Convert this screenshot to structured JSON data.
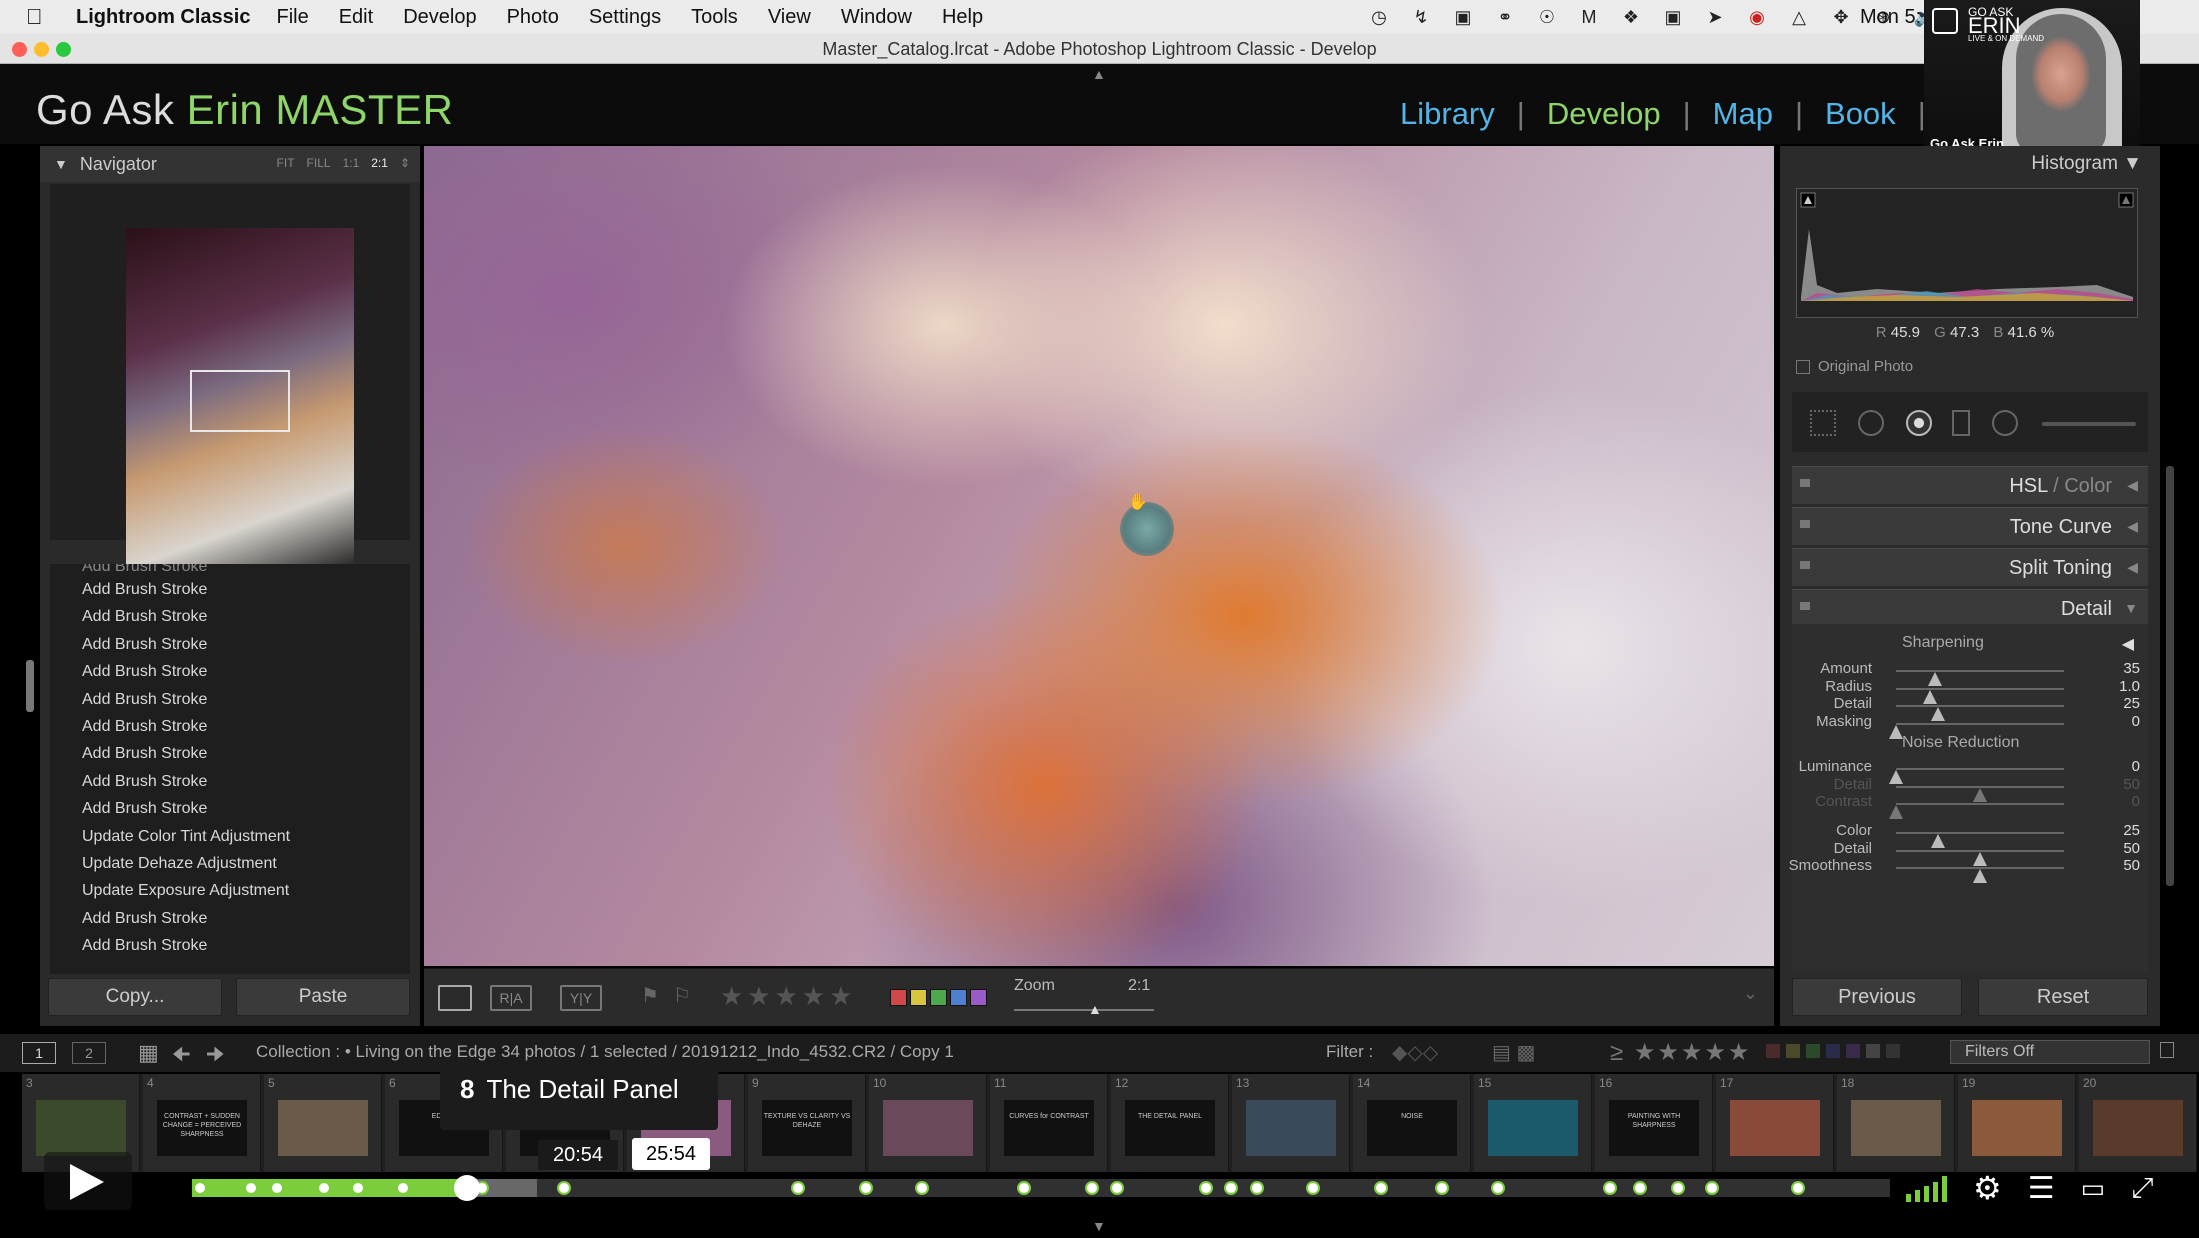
{
  "menubar": {
    "app_name": "Lightroom Classic",
    "items": [
      "File",
      "Edit",
      "Develop",
      "Photo",
      "Settings",
      "Tools",
      "View",
      "Window",
      "Help"
    ],
    "clock": "Mon 5:"
  },
  "window": {
    "title": "Master_Catalog.lrcat - Adobe Photoshop Lightroom Classic - Develop"
  },
  "header": {
    "identity_prefix": "Go Ask ",
    "identity_accent": "Erin MASTER",
    "modules": [
      "Library",
      "Develop",
      "Map",
      "Book"
    ],
    "active_module": "Develop"
  },
  "webcam": {
    "logo_line1": "GO ASK",
    "logo_line2": "ERIN",
    "logo_line3": "LIVE & ON DEMAND",
    "name": "Go Ask Erin"
  },
  "navigator": {
    "title": "Navigator",
    "zoom_options": [
      "FIT",
      "FILL",
      "1:1",
      "2:1"
    ],
    "selected_zoom": "2:1"
  },
  "history": {
    "items": [
      "Add Brush Stroke",
      "Add Brush Stroke",
      "Add Brush Stroke",
      "Add Brush Stroke",
      "Add Brush Stroke",
      "Add Brush Stroke",
      "Add Brush Stroke",
      "Add Brush Stroke",
      "Add Brush Stroke",
      "Update Color Tint Adjustment",
      "Update Dehaze Adjustment",
      "Update Exposure Adjustment",
      "Add Brush Stroke",
      "Add Brush Stroke"
    ]
  },
  "left_buttons": {
    "copy": "Copy...",
    "paste": "Paste"
  },
  "toolbar": {
    "zoom_label": "Zoom",
    "zoom_value": "2:1",
    "color_labels": [
      "#d04848",
      "#d8c640",
      "#4caa4c",
      "#4f7fd0",
      "#9a5bc6"
    ]
  },
  "histogram": {
    "title": "Histogram",
    "r_label": "R",
    "r_value": "45.9",
    "g_label": "G",
    "g_value": "47.3",
    "b_label": "B",
    "b_value": "41.6 %",
    "original_photo": "Original Photo"
  },
  "panels": {
    "hsl_a": "HSL",
    "hsl_b": " / Color",
    "tone_curve": "Tone Curve",
    "split_toning": "Split Toning",
    "detail": "Detail"
  },
  "detail": {
    "sharpening_title": "Sharpening",
    "sharpening": [
      {
        "label": "Amount",
        "value": "35",
        "pos": 0.233
      },
      {
        "label": "Radius",
        "value": "1.0",
        "pos": 0.2
      },
      {
        "label": "Detail",
        "value": "25",
        "pos": 0.25
      },
      {
        "label": "Masking",
        "value": "0",
        "pos": 0.0
      }
    ],
    "noise_title": "Noise Reduction",
    "noise": [
      {
        "label": "Luminance",
        "value": "0",
        "pos": 0.0,
        "dim": false
      },
      {
        "label": "Detail",
        "value": "50",
        "pos": 0.5,
        "dim": true
      },
      {
        "label": "Contrast",
        "value": "0",
        "pos": 0.0,
        "dim": true
      },
      {
        "label": "Color",
        "value": "25",
        "pos": 0.25,
        "dim": false
      },
      {
        "label": "Detail",
        "value": "50",
        "pos": 0.5,
        "dim": false
      },
      {
        "label": "Smoothness",
        "value": "50",
        "pos": 0.5,
        "dim": false
      }
    ]
  },
  "right_buttons": {
    "previous": "Previous",
    "reset": "Reset"
  },
  "filmstrip_header": {
    "monitor1": "1",
    "monitor2": "2",
    "collection": "Collection : • Living on the Edge     34 photos / 1 selected / 20191212_Indo_4532.CR2 / Copy 1",
    "filter_label": "Filter :",
    "filters_off": "Filters Off"
  },
  "filmstrip": {
    "cells": [
      {
        "num": "3",
        "color": "#3a4a2a",
        "caption": ""
      },
      {
        "num": "4",
        "color": "#111111",
        "caption": "CONTRAST + SUDDEN CHANGE = PERCEIVED SHARPNESS"
      },
      {
        "num": "5",
        "color": "#6a5a4a",
        "caption": ""
      },
      {
        "num": "6",
        "color": "#111111",
        "caption": "EDGES"
      },
      {
        "num": "7",
        "color": "#111111",
        "caption": "FREQUENCY"
      },
      {
        "num": "8",
        "color": "#8a5a80",
        "caption": ""
      },
      {
        "num": "9",
        "color": "#111111",
        "caption": "TEXTURE VS CLARITY VS DEHAZE"
      },
      {
        "num": "10",
        "color": "#6a4a5a",
        "caption": ""
      },
      {
        "num": "11",
        "color": "#111111",
        "caption": "CURVES for CONTRAST"
      },
      {
        "num": "12",
        "color": "#111111",
        "caption": "THE DETAIL PANEL"
      },
      {
        "num": "13",
        "color": "#3a4a5a",
        "caption": ""
      },
      {
        "num": "14",
        "color": "#111111",
        "caption": "NOISE"
      },
      {
        "num": "15",
        "color": "#1a5a6a",
        "caption": ""
      },
      {
        "num": "16",
        "color": "#111111",
        "caption": "PAINTING WITH SHARPNESS"
      },
      {
        "num": "17",
        "color": "#8a4a3a",
        "caption": ""
      },
      {
        "num": "18",
        "color": "#6a5a4a",
        "caption": ""
      },
      {
        "num": "19",
        "color": "#8a5a3a",
        "caption": ""
      },
      {
        "num": "20",
        "color": "#5a3a2a",
        "caption": ""
      }
    ]
  },
  "player": {
    "chapter_number": "8",
    "chapter_title": "The Detail Panel",
    "current_time": "20:54",
    "hover_time": "25:54",
    "progress": 0.162,
    "buffered": 0.203,
    "chapters": [
      0.005,
      0.035,
      0.05,
      0.078,
      0.098,
      0.124,
      0.171,
      0.219,
      0.357,
      0.397,
      0.43,
      0.49,
      0.53,
      0.545,
      0.597,
      0.612,
      0.627,
      0.66,
      0.7,
      0.736,
      0.769,
      0.835,
      0.853,
      0.875,
      0.895,
      0.946
    ]
  }
}
